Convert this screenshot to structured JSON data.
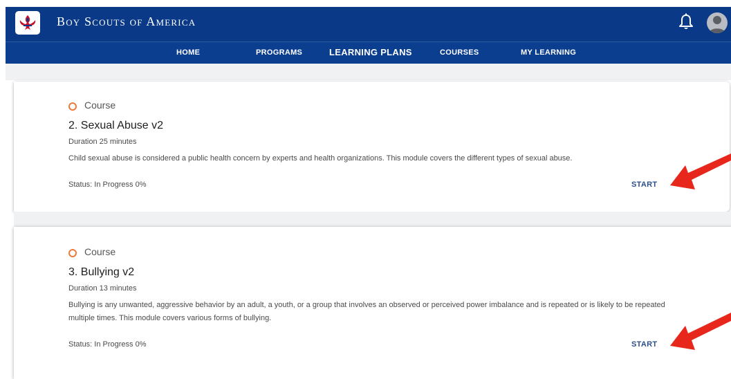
{
  "header": {
    "brand": "Boy Scouts of America",
    "nav": [
      {
        "label": "HOME",
        "active": false
      },
      {
        "label": "PROGRAMS",
        "active": false
      },
      {
        "label": "LEARNING PLANS",
        "active": true
      },
      {
        "label": "COURSES",
        "active": false
      },
      {
        "label": "MY LEARNING",
        "active": false
      }
    ]
  },
  "icons": {
    "logo": "fleur-de-lis-icon",
    "notifications": "bell-icon",
    "profile": "avatar-icon",
    "course_marker": "circle-icon",
    "annotation": "red-arrow-icon"
  },
  "colors": {
    "header_bg": "#0a3a87",
    "course_marker": "#f07a3a",
    "start_link": "#2c4f8a",
    "annotation_arrow": "#e8271c"
  },
  "courses": [
    {
      "type": "Course",
      "title": "2. Sexual Abuse v2",
      "duration": "Duration 25 minutes",
      "description": "Child sexual abuse is considered a public health concern by experts and health organizations. This module covers the different types of sexual abuse.",
      "status": "Status: In Progress 0%",
      "action": "START"
    },
    {
      "type": "Course",
      "title": "3. Bullying v2",
      "duration": "Duration 13 minutes",
      "description": "Bullying is any unwanted, aggressive behavior by an adult, a youth, or a group that involves an observed or perceived power imbalance and is repeated or is likely to be repeated multiple times. This module covers various forms of bullying.",
      "status": "Status: In Progress 0%",
      "action": "START"
    }
  ]
}
